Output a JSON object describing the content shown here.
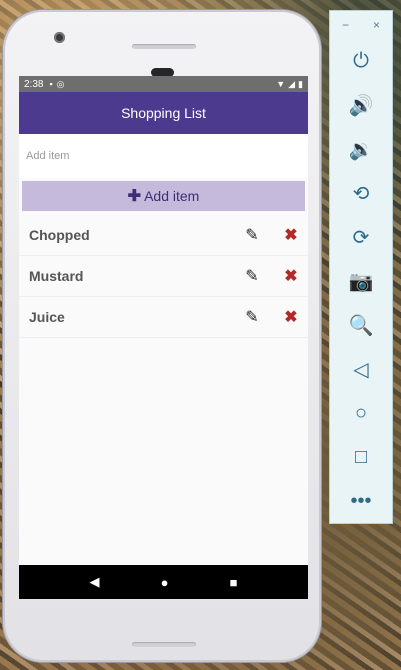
{
  "status_bar": {
    "time": "2:38"
  },
  "app_bar": {
    "title": "Shopping List"
  },
  "input": {
    "placeholder": "Add item",
    "value": ""
  },
  "add_button": {
    "label": "Add item"
  },
  "items": [
    {
      "name": "Chopped"
    },
    {
      "name": "Mustard"
    },
    {
      "name": "Juice"
    }
  ],
  "colors": {
    "app_bar": "#4b3a8e",
    "add_button_bg": "#c5b9dc",
    "delete_icon": "#b02a2a"
  },
  "icons": {
    "row_actions": [
      "edit-icon",
      "delete-icon"
    ],
    "nav": [
      "back-icon",
      "home-icon",
      "recents-icon"
    ],
    "emulator_tools": [
      "power-icon",
      "volume-up-icon",
      "volume-down-icon",
      "rotate-left-icon",
      "rotate-right-icon",
      "camera-icon",
      "zoom-icon",
      "back-icon",
      "home-icon",
      "overview-icon",
      "more-icon"
    ]
  },
  "emulator_panel": {
    "minimize": "−",
    "close": "×"
  }
}
